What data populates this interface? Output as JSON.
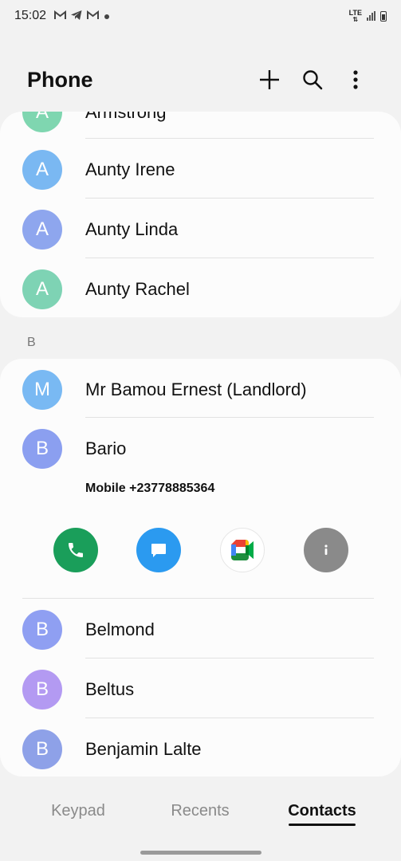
{
  "status_bar": {
    "time": "15:02",
    "notification_icons": [
      "gmail-icon",
      "telegram-icon",
      "gmail-icon",
      "dot-icon"
    ],
    "network": "LTE"
  },
  "header": {
    "title": "Phone",
    "actions": [
      "add-icon",
      "search-icon",
      "more-options-icon"
    ]
  },
  "contacts_a": [
    {
      "initial": "A",
      "name": "Armstrong",
      "color": "#7fd6b0"
    },
    {
      "initial": "A",
      "name": "Aunty Irene",
      "color": "#7ab8f2"
    },
    {
      "initial": "A",
      "name": "Aunty Linda",
      "color": "#8ea6ee"
    },
    {
      "initial": "A",
      "name": "Aunty Rachel",
      "color": "#7ed3b4"
    }
  ],
  "section_b": {
    "letter": "B"
  },
  "contacts_b": [
    {
      "initial": "M",
      "name": "Mr Bamou Ernest (Landlord)",
      "color": "#79b9f3"
    },
    {
      "initial": "B",
      "name": "Bario",
      "color": "#8b9ff0"
    },
    {
      "initial": "B",
      "name": "Belmond",
      "color": "#8f9ff2"
    },
    {
      "initial": "B",
      "name": "Beltus",
      "color": "#b39af2"
    },
    {
      "initial": "B",
      "name": "Benjamin Lalte",
      "color": "#8ea1e8"
    }
  ],
  "expanded_contact": {
    "detail": "Mobile +23778885364",
    "actions": [
      {
        "name": "call",
        "color": "#1a9e5a"
      },
      {
        "name": "message",
        "color": "#2b9af0"
      },
      {
        "name": "video-call",
        "color": "#ffffff"
      },
      {
        "name": "info",
        "color": "#8a8a8a"
      }
    ]
  },
  "tabs": [
    {
      "label": "Keypad",
      "active": false
    },
    {
      "label": "Recents",
      "active": false
    },
    {
      "label": "Contacts",
      "active": true
    }
  ]
}
